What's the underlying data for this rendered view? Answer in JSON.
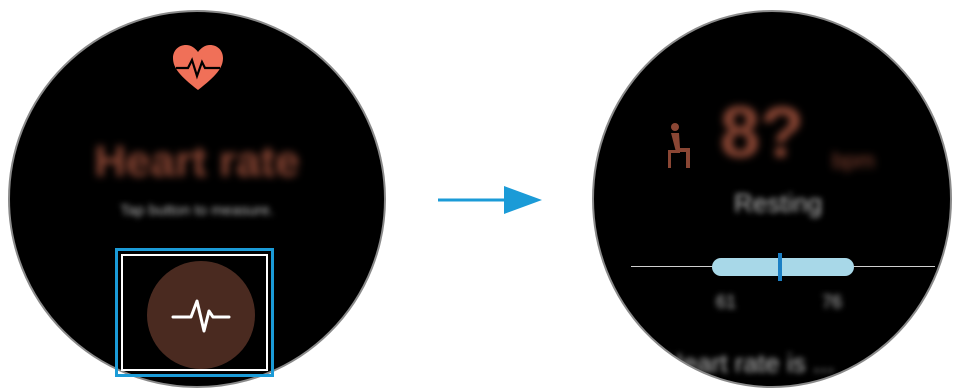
{
  "left_watch": {
    "title": "Heart rate",
    "hint": "Tap button to measure.",
    "measure_button_label": "heart-rate-measure",
    "icons": {
      "heart": "heart-icon",
      "pulse": "pulse-icon"
    }
  },
  "right_watch": {
    "bpm_value": "8?",
    "bpm_unit": "bpm",
    "status": "Resting",
    "range_min": "61",
    "range_max": "76",
    "range_marker_fraction": 0.48,
    "footer": "Heart rate is ...",
    "icons": {
      "sitting": "sitting-person-icon"
    }
  },
  "arrow": {
    "icon": "arrow-right-icon",
    "color": "#1b9bd7"
  },
  "colors": {
    "accent_red": "#f07058",
    "button_brown": "#4a2a20",
    "highlight_blue": "#1b9bd7",
    "range_fill": "#a8d8e8"
  }
}
